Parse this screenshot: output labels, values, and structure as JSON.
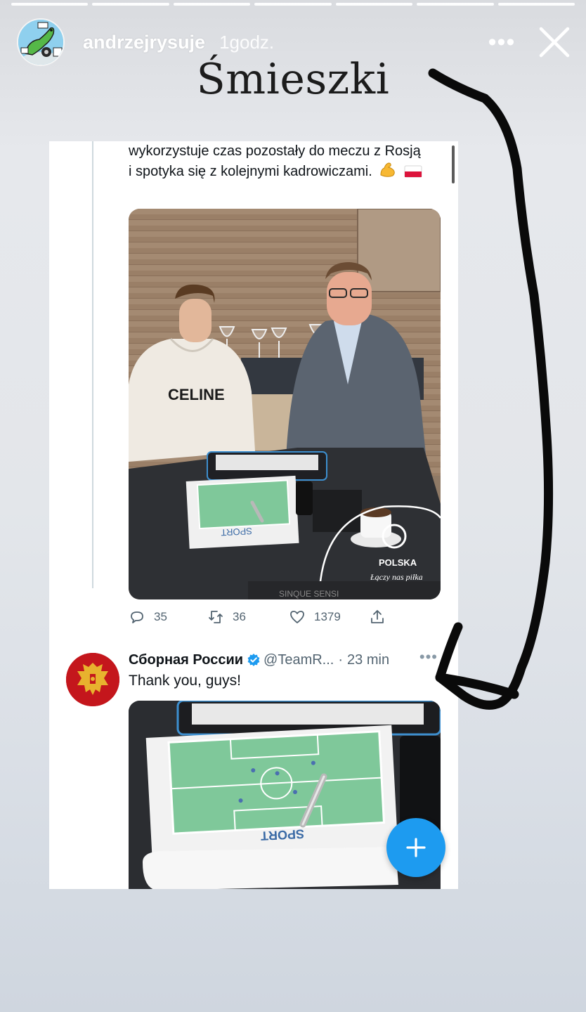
{
  "story": {
    "username": "andrzejrysuje",
    "time": "1godz.",
    "more_glyph": "•••",
    "caption": "Śmieszki",
    "progress_segments": 7,
    "icons": [
      "avatar-illustration",
      "more-icon",
      "close-icon",
      "hand-drawn-arrow"
    ]
  },
  "tweet1": {
    "text": "wykorzystuje czas pozostały do meczu z Rosją i spotyka się z kolejnymi kadrowiczami.",
    "emojis": [
      "flexed-biceps",
      "poland-flag"
    ],
    "photo": {
      "hoodie_text": "CELINE",
      "badge_line1": "POLSKA",
      "badge_line2": "Łączy nas piłka",
      "pad_text": "SINQUE SENSI"
    },
    "actions": {
      "replies": "35",
      "retweets": "36",
      "likes": "1379"
    }
  },
  "tweet2": {
    "name": "Сборная России",
    "handle": "@TeamR...",
    "sep": "·",
    "time": "23 min",
    "more_glyph": "•••",
    "text": "Thank you, guys!",
    "photo": {
      "pad_text": "SPORT"
    }
  },
  "colors": {
    "twitter_blue": "#1d9bf0",
    "verified_blue": "#1d9bf0",
    "russia_red": "#c4161c",
    "pitch_green": "#7fc89a",
    "caption_ink": "#1c1c1c"
  }
}
